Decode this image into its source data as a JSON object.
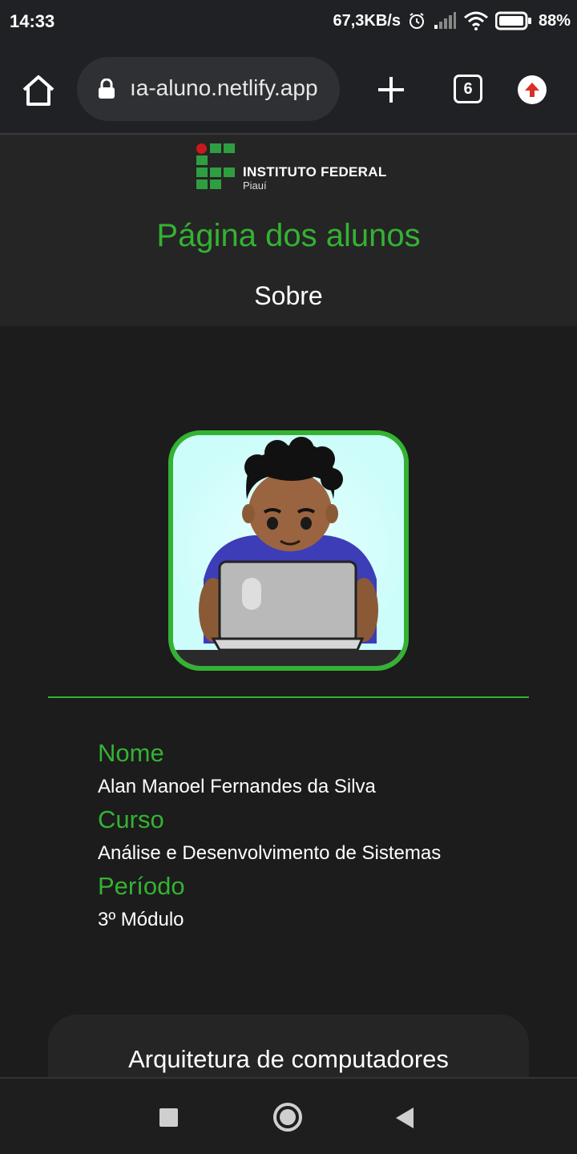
{
  "status_bar": {
    "time": "14:33",
    "net_speed": "67,3KB/s",
    "battery_pct": "88%",
    "icons": [
      "alarm-icon",
      "cell-signal-icon",
      "wifi-icon",
      "battery-icon"
    ]
  },
  "browser": {
    "url": "ıa-aluno.netlify.app",
    "tab_count": "6",
    "icons": [
      "home-icon",
      "lock-icon",
      "new-tab-plus-icon",
      "update-arrow-icon"
    ]
  },
  "site": {
    "logo": {
      "name": "INSTITUTO FEDERAL",
      "campus": "Piauí"
    },
    "title": "Página dos alunos",
    "nav": {
      "sobre": "Sobre"
    }
  },
  "profile": {
    "fields": [
      {
        "label": "Nome",
        "value": "Alan Manoel Fernandes da Silva"
      },
      {
        "label": "Curso",
        "value": "Análise e Desenvolvimento de Sistemas"
      },
      {
        "label": "Período",
        "value": "3º Módulo"
      }
    ]
  },
  "cards": [
    {
      "title": "Arquitetura de computadores"
    }
  ],
  "colors": {
    "accent": "#34b233",
    "background": "#1c1c1c",
    "header_bg": "#252525",
    "avatar_bg": "#cdfdfa"
  }
}
